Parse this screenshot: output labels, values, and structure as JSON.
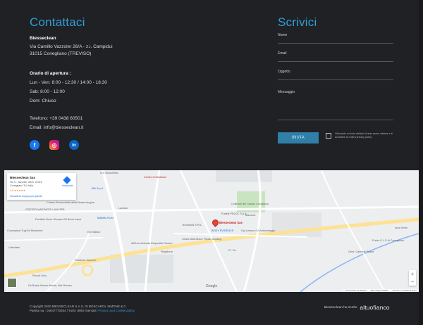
{
  "contact": {
    "title": "Contattaci",
    "company": "Biesseclean",
    "address_line1": "Via Camillo Vazzoler 26/A - z.i. Campidui",
    "address_line2": "31015 Conegliano (TREVISO)",
    "hours_title": "Orario di apertura :",
    "hours_weekdays": "Lun - Ven: 8:00 - 12:30 / 14:00 - 18:30",
    "hours_saturday": "Sab: 8:00 - 12:00",
    "hours_sunday": "Dom: Chiuso",
    "phone": "Telefono: +39 0438 60501",
    "email": "Email: info@biesseclean.it",
    "socials": [
      {
        "icon": "facebook-icon",
        "glyph": "f"
      },
      {
        "icon": "instagram-icon",
        "glyph": "◎"
      },
      {
        "icon": "linkedin-icon",
        "glyph": "in"
      }
    ]
  },
  "form": {
    "title": "Scrivici",
    "name_label": "Nome",
    "email_label": "Email",
    "subject_label": "Oggetto",
    "message_label": "Messaggio",
    "send_label": "INVIA",
    "privacy_text": "Cliccando su invia dichiari di aver preso visione e di accettare la nostra privacy policy."
  },
  "map": {
    "card_name": "Biesseclean Sas",
    "card_address": "Via C. Vazzoler, 26/A, 31015 Conegliano TV, Italia",
    "card_rating": "4,6 ★★★★★",
    "card_link": "Visualizza mappa più grande",
    "card_directions": "Indicazioni",
    "pin_label": "Biesseclean Sas",
    "google": "Google",
    "zoom_in": "+",
    "zoom_out": "−",
    "footer_items": [
      "Scorciatoie da tastiera",
      "Dati mappa ©2021",
      "Termini e condizioni d'uso"
    ],
    "labels": [
      {
        "text": "ICS Bruschetta",
        "cls": ""
      },
      {
        "text": "Centro di Medicina",
        "cls": "red"
      },
      {
        "text": "MD S.p.A",
        "cls": "blue"
      },
      {
        "text": "Chiesa Parrocchiale della Beata Vergine",
        "cls": ""
      },
      {
        "text": "CENTRO MASSAGGI LAVA SPA",
        "cls": ""
      },
      {
        "text": "Panificio Bruni Giovanni Di Bruni Ivana",
        "cls": ""
      },
      {
        "text": "Lazzaro",
        "cls": ""
      },
      {
        "text": "MiMiMo RUN",
        "cls": "blue"
      },
      {
        "text": "Eni Station",
        "cls": ""
      },
      {
        "text": "Fratelli PEDOL S.p.A.",
        "cls": ""
      },
      {
        "text": "Tecnofluid S.P.A.",
        "cls": ""
      },
      {
        "text": "BODY EVIDENCE",
        "cls": "blue"
      },
      {
        "text": "Unica Multi-Motor Plastic Molding",
        "cls": ""
      },
      {
        "text": "ADA srl Azienda Dispositivi Oculari",
        "cls": ""
      },
      {
        "text": "Plastiform",
        "cls": ""
      },
      {
        "text": "Dry Lesson Grl Autonoleggio",
        "cls": ""
      },
      {
        "text": "Pt. Gc.",
        "cls": ""
      },
      {
        "text": "Area Work",
        "cls": ""
      },
      {
        "text": "Punto G.L.S di Conegliano",
        "cls": ""
      },
      {
        "text": "Conceptual Tugi Mr Blackmire",
        "cls": ""
      },
      {
        "text": "Udeuliste",
        "cls": ""
      },
      {
        "text": "Piccoli Givo",
        "cls": ""
      },
      {
        "text": "De Bosia Motors Aberth, Alfa Romeo",
        "cls": ""
      },
      {
        "text": "Rotatoria Sausere",
        "cls": ""
      },
      {
        "text": "Gent. Gabriele Pesce",
        "cls": ""
      },
      {
        "text": "Collinare dei Casale Conigliano",
        "cls": "poi"
      },
      {
        "text": "Manzoor",
        "cls": ""
      }
    ]
  },
  "footer": {
    "copyright": "Copyright 2020 BIESSECLEAN S.A.S. DI BOSCAROL SIMONE & C.",
    "vat": "Partita Iva : 04847770264 | Tutti i diritti riservati |",
    "privacy_link": "Privacy and Cookie policy",
    "chose": "Biesseclean ha scelto",
    "brand": "altuofianco"
  }
}
